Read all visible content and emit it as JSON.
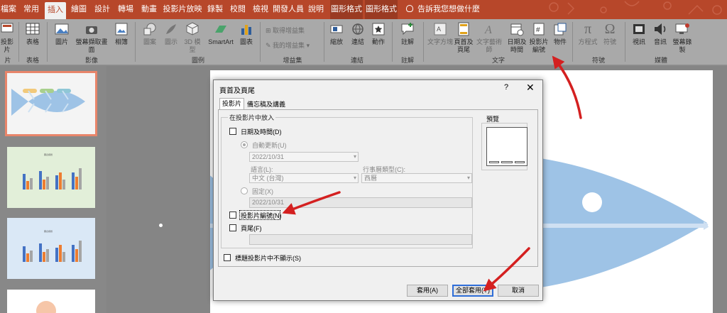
{
  "tabs": [
    {
      "label": "檔案"
    },
    {
      "label": "常用"
    },
    {
      "label": "插入"
    },
    {
      "label": "繪圖"
    },
    {
      "label": "設計"
    },
    {
      "label": "轉場"
    },
    {
      "label": "動畫"
    },
    {
      "label": "投影片放映"
    },
    {
      "label": "錄製"
    },
    {
      "label": "校閱"
    },
    {
      "label": "檢視"
    },
    {
      "label": "開發人員"
    },
    {
      "label": "說明"
    },
    {
      "label": "圖形格式"
    },
    {
      "label": "圖形格式"
    }
  ],
  "tell_me": "告訴我您想做什麼",
  "ribbon": {
    "slides": {
      "label": "投影片",
      "group": "片"
    },
    "table": {
      "label": "表格",
      "group": "表格"
    },
    "images": {
      "picture": "圖片",
      "screenshot": "螢幕擷取畫面",
      "album": "相簿",
      "group": "影像"
    },
    "illustrations": {
      "shapes": "圖案",
      "icons": "圖示",
      "models": "3D 模型",
      "smartart": "SmartArt",
      "chart": "圖表",
      "group": "圖例"
    },
    "addins": {
      "get": "取得增益集",
      "mine": "我的增益集",
      "group": "增益集"
    },
    "links": {
      "zoom": "縮放",
      "link": "連結",
      "action": "動作",
      "group": "連結"
    },
    "comments": {
      "comment": "註解",
      "group": "註解"
    },
    "text": {
      "textbox": "文字方塊",
      "header_footer": "頁首及頁尾",
      "wordart": "文字藝術師",
      "datetime": "日期及時間",
      "slide_number": "投影片編號",
      "object": "物件",
      "group": "文字"
    },
    "symbols": {
      "equation": "方程式",
      "symbol": "符號",
      "group": "符號"
    },
    "media": {
      "video": "視訊",
      "audio": "音訊",
      "screen_recording": "螢幕錄製",
      "group": "媒體"
    }
  },
  "dialog": {
    "title": "頁首及頁尾",
    "help": "?",
    "close": "✕",
    "tab_slide": "投影片",
    "tab_notes": "備忘稿及講義",
    "fieldset_title": "在投影片中放入",
    "date_time": "日期及時間(D)",
    "auto_update": "自動更新(U)",
    "auto_date": "2022/10/31",
    "language_label": "語言(L):",
    "language_value": "中文 (台灣)",
    "calendar_label": "行事曆類型(C):",
    "calendar_value": "西曆",
    "fixed": "固定(X)",
    "fixed_value": "2022/10/31",
    "slide_number": "投影片編號(N)",
    "footer": "頁尾(F)",
    "footer_value": "",
    "title_slide_hide": "標題投影片中不顯示(S)",
    "preview_label": "預覽",
    "apply": "套用(A)",
    "apply_all": "全部套用(Y)",
    "cancel": "取消"
  },
  "thumb_charts": [
    {
      "title": "圖表標題"
    },
    {
      "title": "圖表標題"
    }
  ],
  "colors": {
    "accent": "#b7472a",
    "arrow": "#d42020",
    "fish": "#9ec3e6"
  }
}
